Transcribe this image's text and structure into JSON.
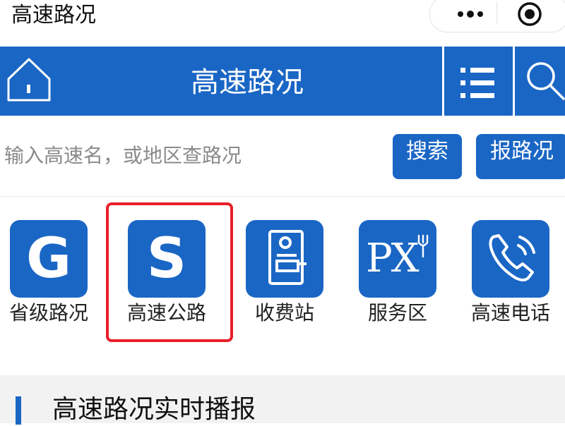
{
  "app": {
    "title": "高速路况"
  },
  "header": {
    "title": "高速路况"
  },
  "search": {
    "placeholder": "输入高速名，或地区查路况",
    "search_label": "搜索",
    "report_label": "报路况"
  },
  "tiles": [
    {
      "letter": "G",
      "label": "省级路况"
    },
    {
      "letter": "S",
      "label": "高速公路"
    },
    {
      "label": "收费站"
    },
    {
      "letter": "PX",
      "label": "服务区"
    },
    {
      "label": "高速电话"
    }
  ],
  "broadcast": {
    "title": "高速路况实时播报"
  },
  "colors": {
    "primary": "#1a66c5",
    "highlight": "#e8202a",
    "section_bg": "#f2f2f2"
  }
}
